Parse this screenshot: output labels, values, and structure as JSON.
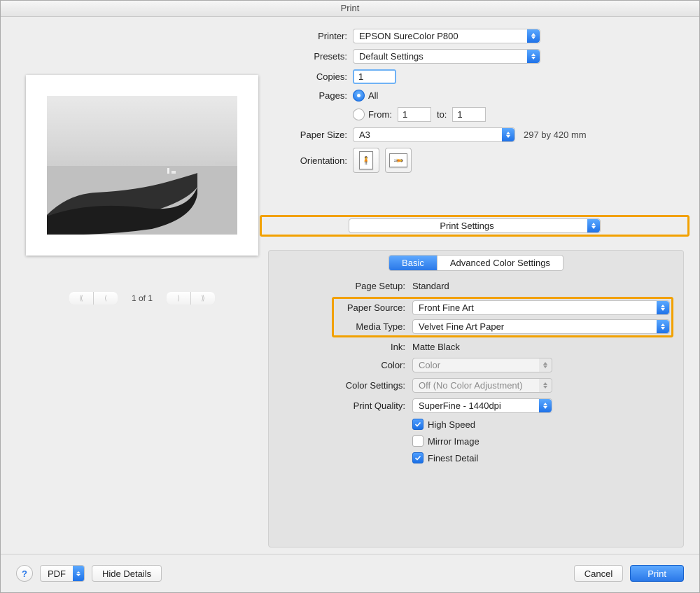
{
  "window": {
    "title": "Print"
  },
  "form": {
    "printer_label": "Printer:",
    "printer_value": "EPSON SureColor P800",
    "presets_label": "Presets:",
    "presets_value": "Default Settings",
    "copies_label": "Copies:",
    "copies_value": "1",
    "pages_label": "Pages:",
    "pages_all_label": "All",
    "pages_from_label": "From:",
    "pages_from_value": "1",
    "pages_to_label": "to:",
    "pages_to_value": "1",
    "paper_size_label": "Paper Size:",
    "paper_size_value": "A3",
    "paper_size_dims": "297 by 420 mm",
    "orientation_label": "Orientation:"
  },
  "pager": {
    "text": "1 of 1"
  },
  "section_selector": "Print Settings",
  "tabs": {
    "basic": "Basic",
    "advanced": "Advanced Color Settings"
  },
  "settings": {
    "page_setup_label": "Page Setup:",
    "page_setup_value": "Standard",
    "paper_source_label": "Paper Source:",
    "paper_source_value": "Front Fine Art",
    "media_type_label": "Media Type:",
    "media_type_value": "Velvet Fine Art Paper",
    "ink_label": "Ink:",
    "ink_value": "Matte Black",
    "color_label": "Color:",
    "color_value": "Color",
    "color_settings_label": "Color Settings:",
    "color_settings_value": "Off (No Color Adjustment)",
    "print_quality_label": "Print Quality:",
    "print_quality_value": "SuperFine - 1440dpi",
    "high_speed_label": "High Speed",
    "mirror_image_label": "Mirror Image",
    "finest_detail_label": "Finest Detail"
  },
  "buttons": {
    "help": "?",
    "pdf": "PDF",
    "hide_details": "Hide Details",
    "cancel": "Cancel",
    "print": "Print"
  }
}
